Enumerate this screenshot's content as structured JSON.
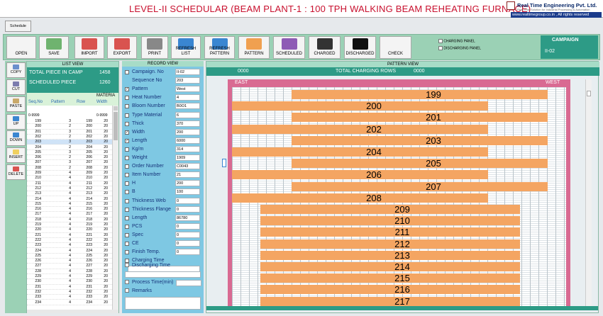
{
  "title": "LEVEL-II SCHEDULAR (BEAM PLANT-1 : 100 TPH WALKING BEAM REHEATING FURNACE)",
  "company": {
    "name": "Real Time Engineering Pvt. Ltd.",
    "tagline": "Real Time Solution for Industrial Processing & Automation",
    "website": "www.realtimegroup.co.in , All rights reserved"
  },
  "tab": "Schedule",
  "toolbar": [
    {
      "label": "OPEN",
      "icon": "folder-open-icon",
      "color": "#f4f4f4"
    },
    {
      "label": "SAVE",
      "icon": "save-icon",
      "color": "#6fb36f"
    },
    {
      "label": "IMPORT",
      "icon": "import-icon",
      "color": "#d9534f"
    },
    {
      "label": "EXPORT",
      "icon": "export-icon",
      "color": "#d9534f"
    },
    {
      "label": "PRINT",
      "icon": "print-icon",
      "color": "#888888"
    },
    {
      "label": "REFRESH LIST",
      "icon": "refresh-list-icon",
      "color": "#3a86d1"
    },
    {
      "label": "REFRESH PATTERN",
      "icon": "refresh-pattern-icon",
      "color": "#3a86d1"
    },
    {
      "label": "PATTERN",
      "icon": "pattern-icon",
      "color": "#f0a050"
    },
    {
      "label": "SCHEDULED",
      "icon": "scheduled-icon",
      "color": "#8e5bb5"
    },
    {
      "label": "CHARGED",
      "icon": "charged-icon",
      "color": "#333333"
    },
    {
      "label": "DISCHARGED",
      "icon": "discharged-icon",
      "color": "#111111"
    },
    {
      "label": "CHECK",
      "icon": "check-icon",
      "color": "#f4f4f4"
    }
  ],
  "panels": {
    "charging": "CHARGING PANEL",
    "discharging": "DISCHARGING PANEL"
  },
  "campaign": {
    "label": "CAMPAIGN",
    "value": "II-02"
  },
  "side_buttons": [
    "COPY",
    "CUT",
    "PASTE",
    "UP",
    "DOWN",
    "INSERT",
    "DELETE"
  ],
  "list": {
    "title": "LIST VIEW",
    "total_label": "TOTAL PIECE IN CAMP",
    "total_value": "1458",
    "sched_label": "SCHEDULED PIECE",
    "sched_value": "1260",
    "material_label": "MATERIA",
    "headers": [
      "Seq.No",
      "Pattern",
      "Row",
      "Width"
    ],
    "filter": [
      "0-9999",
      "0-9999"
    ],
    "rows": [
      [
        "199",
        "3",
        "199",
        "20"
      ],
      [
        "200",
        "2",
        "200",
        "20"
      ],
      [
        "201",
        "3",
        "201",
        "20"
      ],
      [
        "202",
        "2",
        "202",
        "20"
      ],
      [
        "203",
        "3",
        "203",
        "20"
      ],
      [
        "204",
        "2",
        "204",
        "20"
      ],
      [
        "205",
        "3",
        "205",
        "20"
      ],
      [
        "206",
        "2",
        "206",
        "20"
      ],
      [
        "207",
        "3",
        "207",
        "20"
      ],
      [
        "208",
        "2",
        "208",
        "20"
      ],
      [
        "209",
        "4",
        "209",
        "20"
      ],
      [
        "210",
        "4",
        "210",
        "20"
      ],
      [
        "211",
        "4",
        "211",
        "20"
      ],
      [
        "212",
        "4",
        "212",
        "20"
      ],
      [
        "213",
        "4",
        "213",
        "20"
      ],
      [
        "214",
        "4",
        "214",
        "20"
      ],
      [
        "215",
        "4",
        "215",
        "20"
      ],
      [
        "216",
        "4",
        "216",
        "20"
      ],
      [
        "217",
        "4",
        "217",
        "20"
      ],
      [
        "218",
        "4",
        "218",
        "20"
      ],
      [
        "219",
        "4",
        "219",
        "20"
      ],
      [
        "220",
        "4",
        "220",
        "20"
      ],
      [
        "221",
        "4",
        "221",
        "20"
      ],
      [
        "222",
        "4",
        "222",
        "20"
      ],
      [
        "223",
        "4",
        "223",
        "20"
      ],
      [
        "224",
        "4",
        "224",
        "20"
      ],
      [
        "225",
        "4",
        "225",
        "20"
      ],
      [
        "226",
        "4",
        "226",
        "20"
      ],
      [
        "227",
        "4",
        "227",
        "20"
      ],
      [
        "228",
        "4",
        "228",
        "20"
      ],
      [
        "229",
        "4",
        "229",
        "20"
      ],
      [
        "230",
        "4",
        "230",
        "20"
      ],
      [
        "231",
        "4",
        "231",
        "20"
      ],
      [
        "232",
        "4",
        "232",
        "20"
      ],
      [
        "233",
        "4",
        "233",
        "20"
      ],
      [
        "234",
        "4",
        "234",
        "20"
      ]
    ],
    "selected_row": "203"
  },
  "record": {
    "title": "RECORD VIEW",
    "fields": [
      {
        "label": "Campaign. No",
        "value": "II-02"
      },
      {
        "label": "Sequence No",
        "value": "203",
        "nobox": true
      },
      {
        "label": "Pattern",
        "value": "West",
        "checked": true
      },
      {
        "label": "Heat Number",
        "value": "4"
      },
      {
        "label": "Bloom Number",
        "value": "B0O1"
      },
      {
        "label": "Type Material",
        "value": "6"
      },
      {
        "label": "Thick",
        "value": "370"
      },
      {
        "label": "Width",
        "value": "200",
        "checked": true
      },
      {
        "label": "Length",
        "value": "6000",
        "checked": true
      },
      {
        "label": "Kg/m",
        "value": "314"
      },
      {
        "label": "Weight",
        "value": "1909"
      },
      {
        "label": "Order Number",
        "value": "C0043"
      },
      {
        "label": "Item Number",
        "value": "21"
      },
      {
        "label": "H",
        "value": "200"
      },
      {
        "label": "B",
        "value": "100"
      },
      {
        "label": "Thickness Web",
        "value": "0"
      },
      {
        "label": "Thickness Flange",
        "value": "0"
      },
      {
        "label": "Length",
        "value": "86780"
      },
      {
        "label": "PCS",
        "value": "0"
      },
      {
        "label": "Spec",
        "value": "0"
      },
      {
        "label": "CE",
        "value": "0"
      },
      {
        "label": "Finish Temp.",
        "value": "0"
      },
      {
        "label": "Charging Time",
        "value": ""
      }
    ],
    "discharging_time": "Discharging Time",
    "process_time": "Process Time(min)",
    "remarks": "Remarks"
  },
  "pattern": {
    "title": "PATTERN VIEW",
    "left_count": "0000",
    "total_label": "TOTAL CHARGING ROWS",
    "total_value": "0000",
    "east": "EAST",
    "west": "WEST",
    "bars": [
      {
        "num": "199",
        "side": "west"
      },
      {
        "num": "200",
        "side": "east"
      },
      {
        "num": "201",
        "side": "west"
      },
      {
        "num": "202",
        "side": "east"
      },
      {
        "num": "203",
        "side": "west"
      },
      {
        "num": "204",
        "side": "east"
      },
      {
        "num": "205",
        "side": "west"
      },
      {
        "num": "206",
        "side": "east"
      },
      {
        "num": "207",
        "side": "west"
      },
      {
        "num": "208",
        "side": "east"
      },
      {
        "num": "209",
        "side": "center"
      },
      {
        "num": "210",
        "side": "center"
      },
      {
        "num": "211",
        "side": "center"
      },
      {
        "num": "212",
        "side": "center"
      },
      {
        "num": "213",
        "side": "center"
      },
      {
        "num": "214",
        "side": "center"
      },
      {
        "num": "215",
        "side": "center"
      },
      {
        "num": "216",
        "side": "center"
      },
      {
        "num": "217",
        "side": "center"
      }
    ]
  }
}
